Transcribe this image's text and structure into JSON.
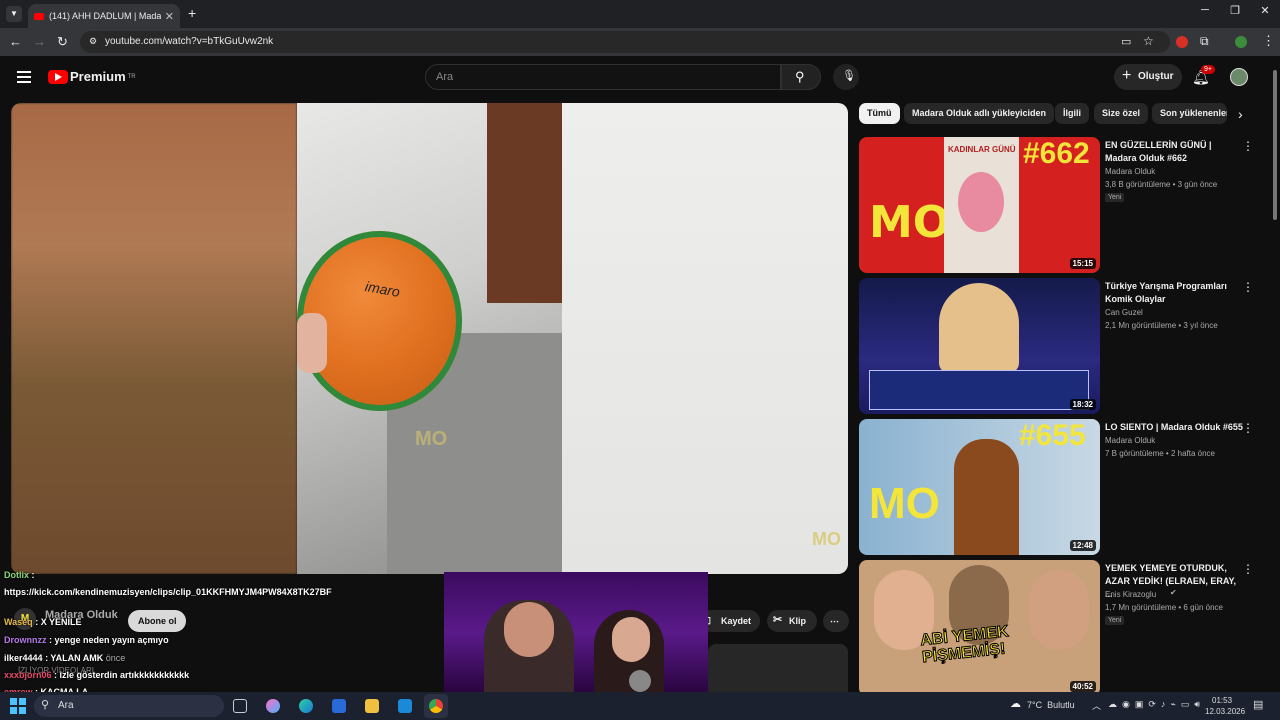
{
  "browser": {
    "tab_title": "(141) AHH DADLUM | Madara O",
    "url": "youtube.com/watch?v=bTkGuUvw2nk"
  },
  "header": {
    "logo_text": "Premium",
    "region": "TR",
    "search_placeholder": "Ara",
    "create_label": "Oluştur",
    "notif_count": "9+"
  },
  "chips": [
    "Tümü",
    "Madara Olduk adlı yükleyiciden",
    "İlgili",
    "Size özel",
    "Son yüklenenler"
  ],
  "recommendations": [
    {
      "title": "EN GÜZELLERİN GÜNÜ | Madara Olduk #662",
      "channel": "Madara Olduk",
      "meta": "3,8 B görüntüleme • 3 gün önce",
      "badge": "Yeni",
      "duration": "15:15",
      "thumb_text": "#662",
      "thumb_sub": "KADINLAR GÜNÜ"
    },
    {
      "title": "Türkiye Yarışma Programları Komik Olaylar",
      "channel": "Can Guzel",
      "meta": "2,1 Mn görüntüleme • 3 yıl önce",
      "badge": "",
      "duration": "18:32",
      "thumb_text": "",
      "thumb_sub": ""
    },
    {
      "title": "LO SIENTO | Madara Olduk #655",
      "channel": "Madara Olduk",
      "meta": "7 B görüntüleme • 2 hafta önce",
      "badge": "",
      "duration": "12:48",
      "thumb_text": "#655",
      "thumb_sub": ""
    },
    {
      "title": "YEMEK YEMEYE OTURDUK, AZAR YEDİK! (ELRAEN, ERAY, ...",
      "channel": "Enis Kirazoglu",
      "meta": "1,7 Mn görüntüleme • 6 gün önce",
      "badge": "Yeni",
      "duration": "40:52",
      "thumb_text": "ABİ YEMEK PİŞMEMİŞ!",
      "thumb_sub": ""
    }
  ],
  "player": {
    "ball_text": "imaro",
    "watermark": "MO"
  },
  "below_player": {
    "channel_name": "Madara Olduk",
    "subscribe_label": "Abone ol",
    "save_label": "Kaydet",
    "clip_label": "Klip",
    "time_ago": "önce",
    "more_videos": "İZLİYOR VİDEOLARI"
  },
  "chat": [
    {
      "user": "Dotlix",
      "msg": ":"
    },
    {
      "user": "",
      "msg": "https://kick.com/kendinemuzisyen/clips/clip_01KKFHMYJM4PW84X8TK27BF"
    },
    {
      "user": "Waseq",
      "msg": ": X YENİLE"
    },
    {
      "user": "Drownnzz",
      "msg": ": yenge neden yayın açmıyo"
    },
    {
      "user": "ilker4444",
      "msg": ": YALAN AMK"
    },
    {
      "user": "xxxbjorn06",
      "msg": ": izle gösterdin artıkkkkkkkkkkk"
    },
    {
      "user": "emrew",
      "msg": ": KAÇMA LA"
    }
  ],
  "taskbar": {
    "search_placeholder": "Ara",
    "weather": "7°C  Bulutlu",
    "time": "01:53",
    "date": "12.03.2026"
  },
  "colors": {
    "bg": "#0f0f0f",
    "accent": "#ff0000",
    "chip_active": "#f1f1f1"
  }
}
